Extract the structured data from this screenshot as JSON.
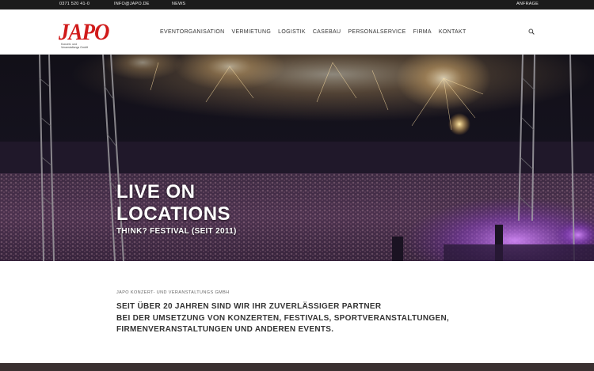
{
  "topbar": {
    "phone": "0371 520 41-0",
    "email": "INFO@JAPO.DE",
    "news": "NEWS",
    "request": "ANFRAGE"
  },
  "logo": {
    "text": "JAPO",
    "subtitle_line1": "Konzert- und",
    "subtitle_line2": "Veranstaltungs GmbH"
  },
  "nav": {
    "items": [
      "EVENTORGANISATION",
      "VERMIETUNG",
      "LOGISTIK",
      "CASEBAU",
      "PERSONALSERVICE",
      "FIRMA",
      "KONTAKT"
    ]
  },
  "hero": {
    "title_line1": "LIVE ON",
    "title_line2": "LOCATIONS",
    "subtitle": "TH!NK? FESTIVAL (SEIT 2011)"
  },
  "intro": {
    "company": "JAPO KONZERT- UND VERANSTALTUNGS GMBH",
    "line1": "SEIT ÜBER 20 JAHREN SIND WIR IHR ZUVERLÄSSIGER PARTNER",
    "line2": "BEI DER UMSETZUNG VON KONZERTEN, FESTIVALS, SPORTVERANSTALTUNGEN,",
    "line3": "FIRMENVERANSTALTUNGEN UND ANDEREN EVENTS."
  },
  "colors": {
    "brand_red": "#d11b1b",
    "topbar_bg": "#1b1b1b",
    "text_dark": "#333333"
  }
}
